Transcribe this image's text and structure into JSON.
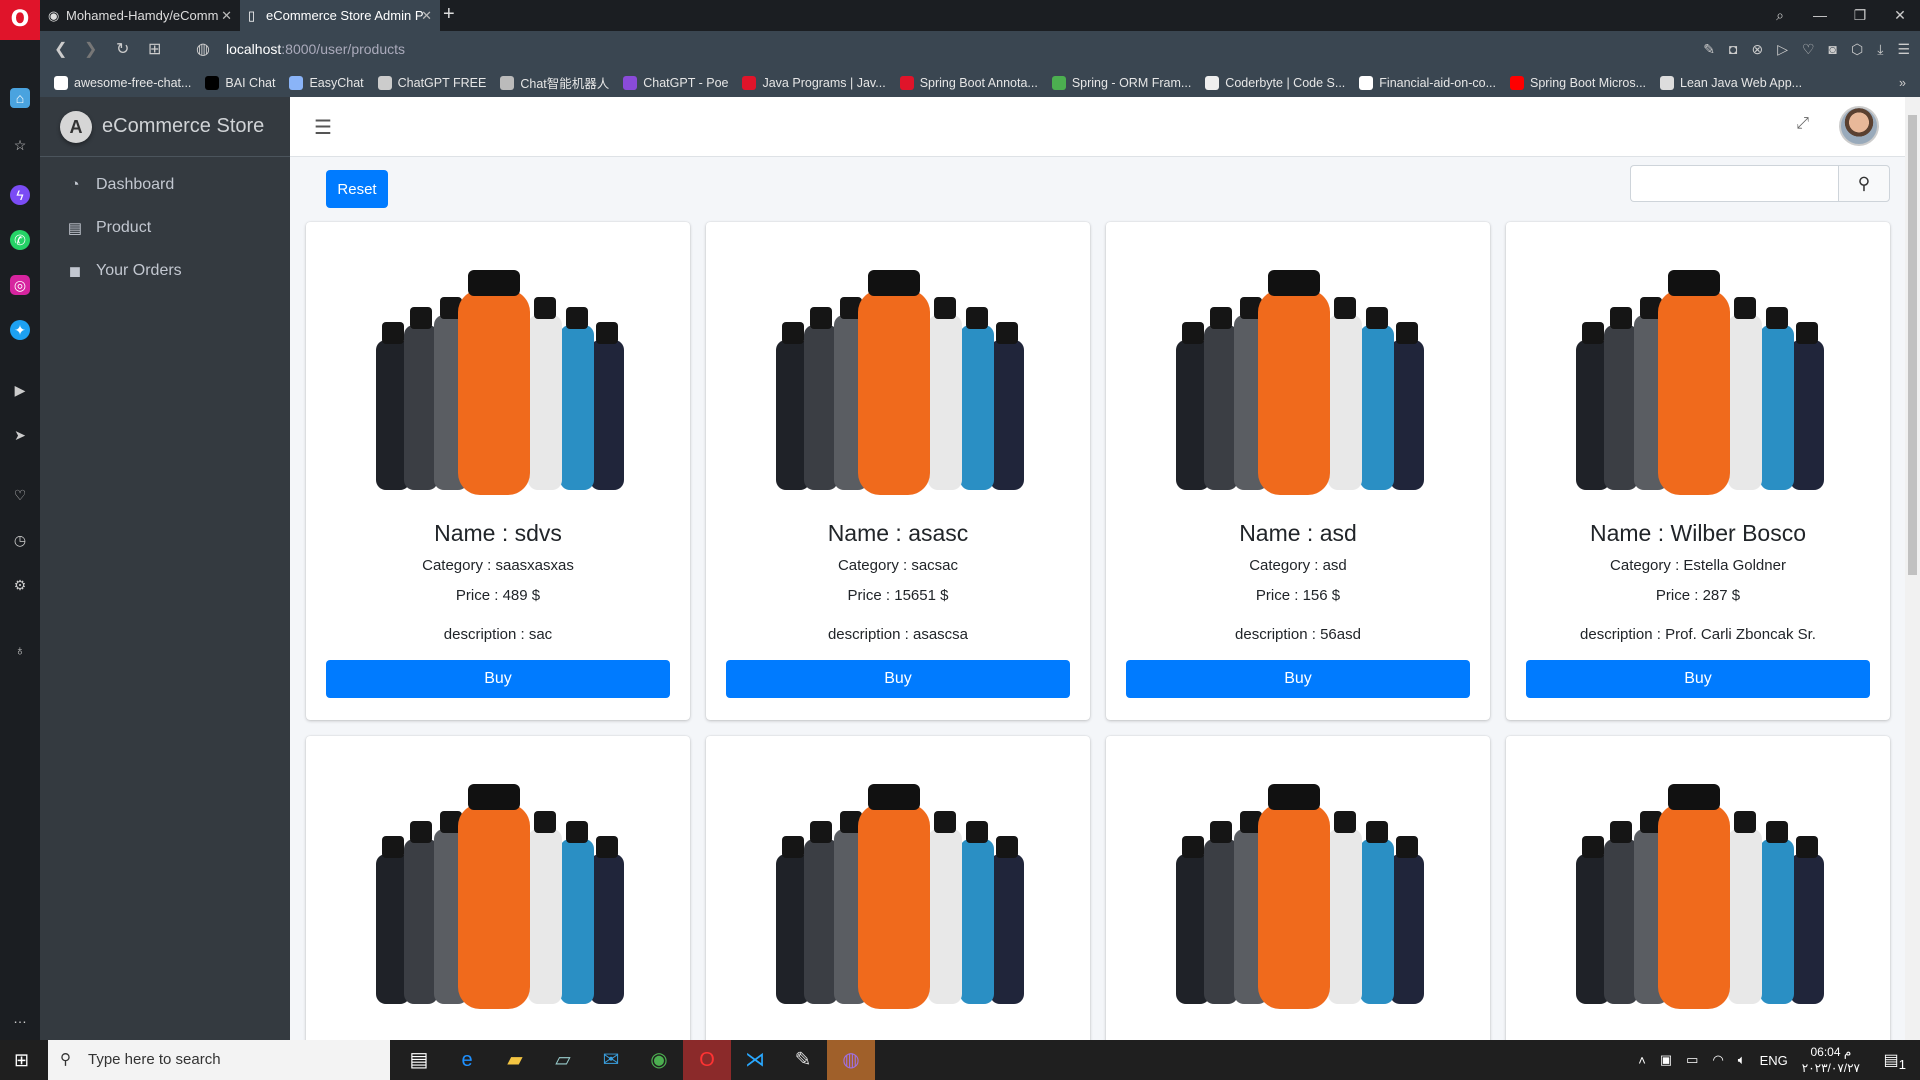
{
  "browser": {
    "tabs": [
      {
        "label": "Mohamed-Hamdy/eComm",
        "icon": "github-icon"
      },
      {
        "label": "eCommerce Store Admin P",
        "icon": "page-icon"
      }
    ],
    "url_host": "localhost",
    "url_path": ":8000/user/products",
    "bookmarks": [
      {
        "label": "awesome-free-chat...",
        "color": "#ffffff"
      },
      {
        "label": "BAI Chat",
        "color": "#000000"
      },
      {
        "label": "EasyChat",
        "color": "#8ab4f8"
      },
      {
        "label": "ChatGPT FREE",
        "color": "#cccccc"
      },
      {
        "label": "Chat智能机器人",
        "color": "#bbbbbb"
      },
      {
        "label": "ChatGPT - Poe",
        "color": "#8a4bd9"
      },
      {
        "label": "Java Programs | Jav...",
        "color": "#e0142a"
      },
      {
        "label": "Spring Boot Annota...",
        "color": "#e0142a"
      },
      {
        "label": "Spring - ORM Fram...",
        "color": "#4caf50"
      },
      {
        "label": "Coderbyte | Code S...",
        "color": "#eeeeee"
      },
      {
        "label": "Financial-aid-on-co...",
        "color": "#ffffff"
      },
      {
        "label": "Spring Boot Micros...",
        "color": "#ff0000"
      },
      {
        "label": "Lean Java Web App...",
        "color": "#dddddd"
      }
    ]
  },
  "app": {
    "brand": "eCommerce Store",
    "logo_letter": "A",
    "menu": [
      {
        "label": "Dashboard",
        "icon": "tachometer-icon"
      },
      {
        "label": "Product",
        "icon": "file-icon"
      },
      {
        "label": "Your Orders",
        "icon": "shopping-bag-icon"
      }
    ],
    "reset_label": "Reset",
    "search_placeholder": "",
    "accent": "#007bff",
    "products": [
      {
        "name": "Name : sdvs",
        "category": "Category : saasxasxas",
        "price": "Price : 489 $",
        "description": "description : sac",
        "buy": "Buy"
      },
      {
        "name": "Name : asasc",
        "category": "Category : sacsac",
        "price": "Price : 15651 $",
        "description": "description : asascsa",
        "buy": "Buy"
      },
      {
        "name": "Name : asd",
        "category": "Category : asd",
        "price": "Price : 156 $",
        "description": "description : 56asd",
        "buy": "Buy"
      },
      {
        "name": "Name : Wilber Bosco",
        "category": "Category : Estella Goldner",
        "price": "Price : 287 $",
        "description": "description : Prof. Carli Zboncak Sr.",
        "buy": "Buy"
      }
    ]
  },
  "taskbar": {
    "search_placeholder": "Type here to search",
    "lang": "ENG",
    "time": "06:04 م",
    "date": "٢٠٢٣/٠٧/٢٧",
    "notifications": "1"
  }
}
